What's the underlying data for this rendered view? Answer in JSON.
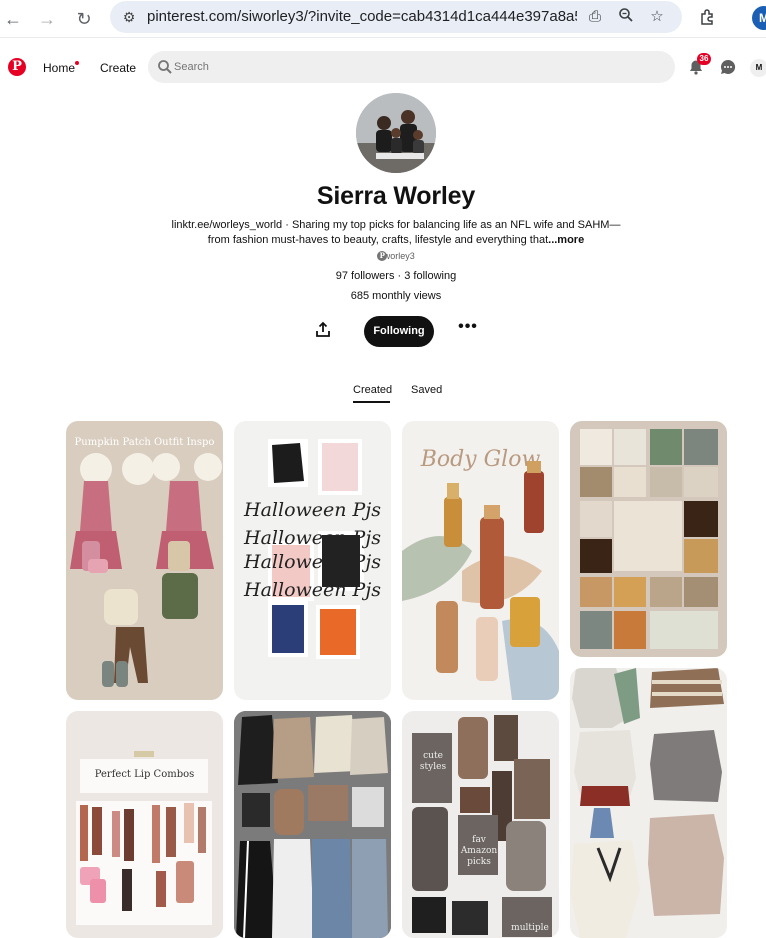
{
  "browser": {
    "url": "pinterest.com/siworley3/?invite_code=cab4314d1ca444e397a8a5d...",
    "profile_initial": "M"
  },
  "header": {
    "home_label": "Home",
    "create_label": "Create",
    "search_placeholder": "Search",
    "notification_count": "36",
    "avatar_initial": "M"
  },
  "profile": {
    "name": "Sierra Worley",
    "bio_link": "linktr.ee/worleys_world",
    "bio_text": " · Sharing my top picks for balancing life as an NFL wife and SAHM— from fashion must-haves to beauty, crafts, lifestyle and everything that",
    "bio_more": "...more",
    "handle": "siworley3",
    "followers": "97 followers",
    "separator": " · ",
    "following_count": "3 following",
    "monthly_views": "685 monthly views",
    "follow_button": "Following"
  },
  "tabs": [
    {
      "label": "Created",
      "active": true
    },
    {
      "label": "Saved",
      "active": false
    }
  ],
  "pins": {
    "pumpkin_title": "Pumpkin Patch Outfit Inspo",
    "halloween_title": "Halloween Pjs",
    "body_glow_title": "Body Glow",
    "lip_title": "Perfect Lip Combos",
    "cute_styles": "cute styles",
    "fav_amazon": "fav Amazon picks",
    "multiple": "multiple"
  },
  "colors": {
    "brand": "#e60023",
    "button_dark": "#111111",
    "search_bg": "#efefef"
  }
}
